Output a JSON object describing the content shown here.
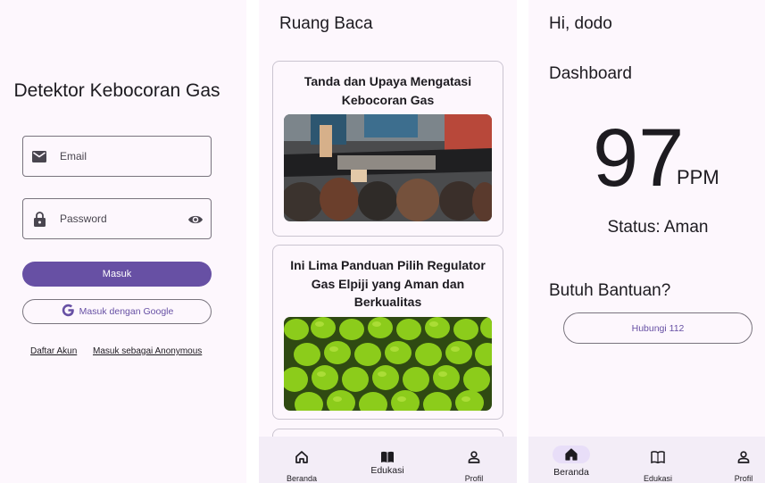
{
  "login": {
    "title": "Detektor Kebocoran Gas",
    "email_placeholder": "Email",
    "password_placeholder": "Password",
    "login_button": "Masuk",
    "google_button": "Masuk dengan Google",
    "register_link": "Daftar Akun",
    "anonymous_link": "Masuk sebagai Anonymous"
  },
  "reading": {
    "title": "Ruang Baca",
    "articles": [
      {
        "title": "Tanda dan Upaya Mengatasi Kebocoran Gas"
      },
      {
        "title": "Ini Lima Panduan Pilih Regulator Gas Elpiji yang Aman dan Berkualitas"
      }
    ],
    "nav": [
      {
        "label": "Beranda",
        "icon": "home-icon"
      },
      {
        "label": "Edukasi",
        "icon": "book-icon"
      },
      {
        "label": "Profil",
        "icon": "person-icon"
      }
    ]
  },
  "dashboard": {
    "greeting": "Hi, dodo",
    "title": "Dashboard",
    "ppm_value": "97",
    "ppm_unit": "PPM",
    "status": "Status: Aman",
    "help_title": "Butuh Bantuan?",
    "call_button": "Hubungi 112",
    "nav": [
      {
        "label": "Beranda",
        "icon": "home-icon"
      },
      {
        "label": "Edukasi",
        "icon": "book-icon"
      },
      {
        "label": "Profil",
        "icon": "person-icon"
      }
    ]
  },
  "colors": {
    "primary": "#6750a4",
    "background": "#fdf7fd",
    "nav_background": "#f3edf7",
    "active_indicator": "#e8def8"
  }
}
